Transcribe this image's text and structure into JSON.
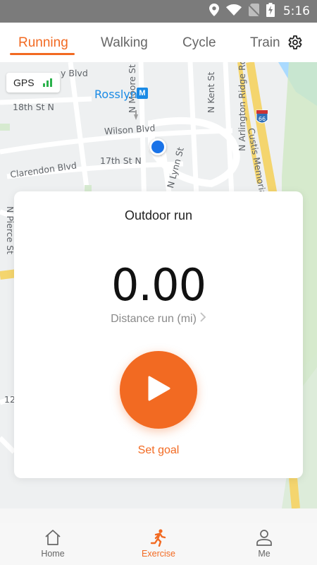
{
  "status_bar": {
    "time": "5:16",
    "icons": [
      "location-icon",
      "wifi-icon",
      "no-sim-icon",
      "battery-charging-icon"
    ]
  },
  "tabs": [
    {
      "label": "Running",
      "active": true
    },
    {
      "label": "Walking",
      "active": false
    },
    {
      "label": "Cycle",
      "active": false
    },
    {
      "label": "Train",
      "active": false
    }
  ],
  "settings_icon": "gear-icon",
  "map": {
    "gps_label": "GPS",
    "metro_station": "Rosslyn",
    "metro_badge": "M",
    "highway_shield": "66",
    "streets": {
      "s1": "y Blvd",
      "s2": "18th St N",
      "s3": "Wilson Blvd",
      "s4": "17th St N",
      "s5": "Clarendon Blvd",
      "s6": "N Moore St",
      "s7": "N Kent St",
      "s8": "N Arlington Ridge Rd",
      "s9": "Custis Memorial",
      "s10": "N Lynn St",
      "s11": "N Pierce St",
      "s12": "12"
    }
  },
  "card": {
    "title": "Outdoor run",
    "distance_value": "0.00",
    "distance_label": "Distance run (mi)",
    "start_icon": "play-icon",
    "set_goal_label": "Set goal"
  },
  "bottom_nav": [
    {
      "label": "Home",
      "icon": "home-icon",
      "active": false
    },
    {
      "label": "Exercise",
      "icon": "running-person-icon",
      "active": true
    },
    {
      "label": "Me",
      "icon": "person-icon",
      "active": false
    }
  ],
  "colors": {
    "accent": "#f26a22",
    "status_bar": "#7b7b7b",
    "metro_blue": "#1a8ae5",
    "gps_green": "#2bb24c",
    "location_blue": "#1a73e8"
  }
}
